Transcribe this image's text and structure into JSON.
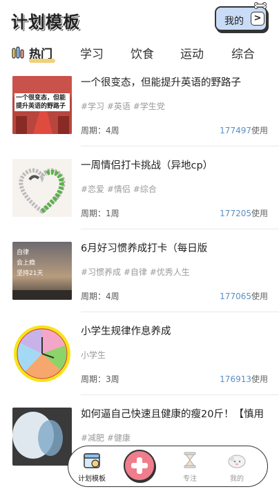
{
  "header": {
    "title": "计划模板",
    "my_button": "我的",
    "my_chevron": ">"
  },
  "tabs": [
    "热门",
    "学习",
    "饮食",
    "运动",
    "综合"
  ],
  "items": [
    {
      "title": "一个很变态，但能提升英语的野路子",
      "tags": "#学习 #英语 #学生党",
      "period": "周期：4周",
      "uses_num": "177497",
      "uses_suffix": "使用",
      "thumb_text": "一个很变态，但能提升英语的野路子"
    },
    {
      "title": "一周情侣打卡挑战（异地cp）",
      "tags": "#恋爱 #情侣 #综合",
      "period": "周期：1周",
      "uses_num": "177205",
      "uses_suffix": "使用"
    },
    {
      "title": "6月好习惯养成打卡（每日版",
      "tags": "#习惯养成 #自律 #优秀人生",
      "period": "周期：4周",
      "uses_num": "177065",
      "uses_suffix": "使用",
      "thumb_lines": [
        "自律",
        "会上瘾",
        "坚持21天"
      ]
    },
    {
      "title": "小学生规律作息养成",
      "tags": "小学生",
      "period": "周期：3周",
      "uses_num": "176913",
      "uses_suffix": "使用"
    },
    {
      "title": "如何逼自己快速且健康的瘦20斤！【慎用",
      "tags": "#减肥 #健康",
      "period": "",
      "uses_num": "",
      "uses_suffix": ""
    }
  ],
  "bottom_nav": {
    "plan": "计划模板",
    "focus": "专注",
    "mine": "我的"
  },
  "colors": {
    "accent_blue": "#5a8ec5",
    "tab_underline": "#f1d07a",
    "add_button": "#f07d8c",
    "my_button_bg": "#c9dcf7"
  }
}
